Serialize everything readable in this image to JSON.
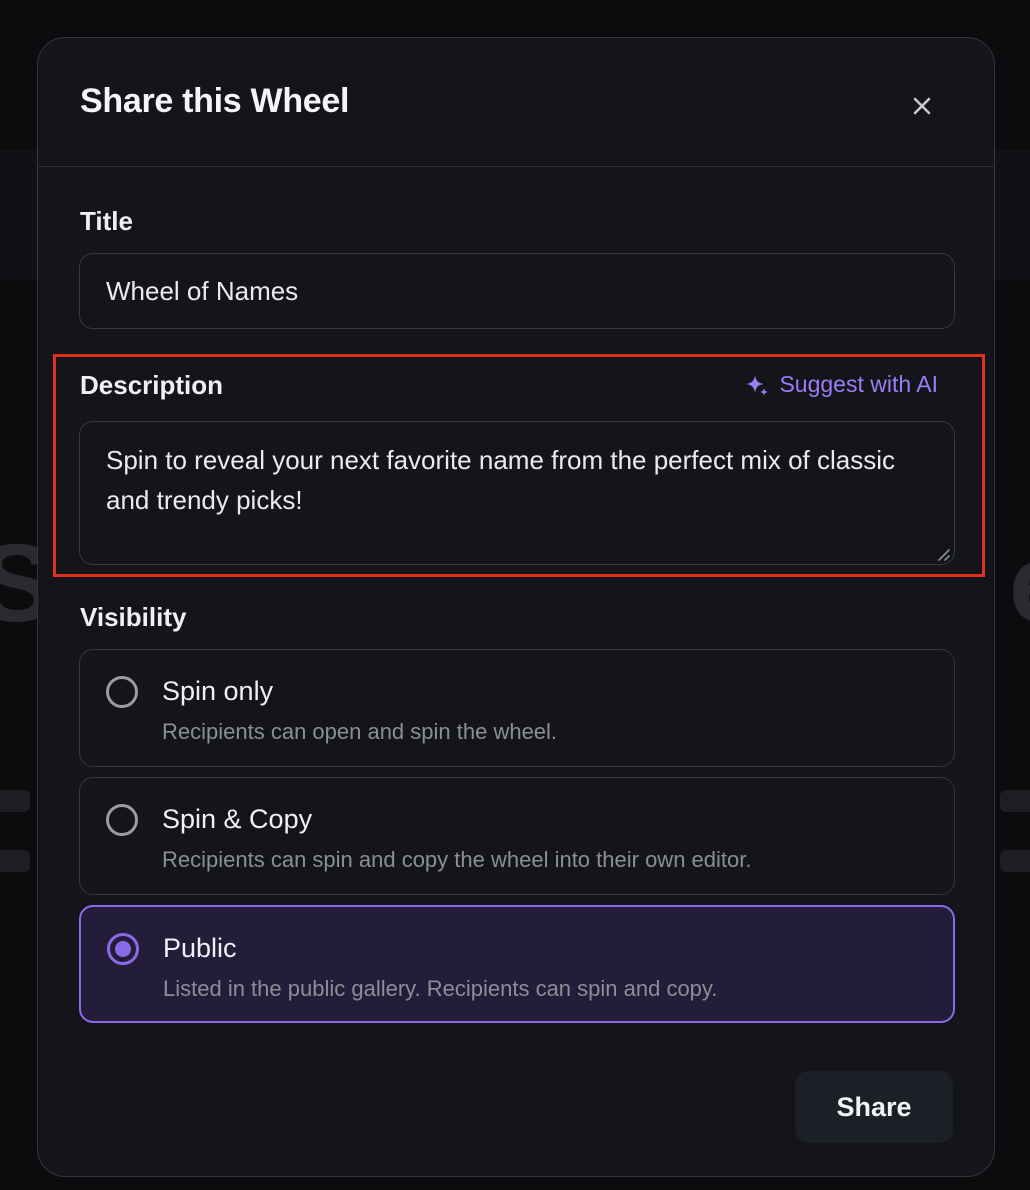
{
  "modal": {
    "title": "Share this Wheel"
  },
  "title_field": {
    "label": "Title",
    "value": "Wheel of Names"
  },
  "description_field": {
    "label": "Description",
    "suggest_label": "Suggest with AI",
    "value": "Spin to reveal your next favorite name from the perfect mix of classic and trendy picks!"
  },
  "visibility": {
    "label": "Visibility",
    "selected": "public",
    "options": [
      {
        "id": "spin-only",
        "title": "Spin only",
        "description": "Recipients can open and spin the wheel."
      },
      {
        "id": "spin-copy",
        "title": "Spin & Copy",
        "description": "Recipients can spin and copy the wheel into their own editor."
      },
      {
        "id": "public",
        "title": "Public",
        "description": "Listed in the public gallery. Recipients can spin and copy."
      }
    ]
  },
  "actions": {
    "share_label": "Share"
  },
  "colors": {
    "accent": "#8b6ae9",
    "highlight": "#e0301e"
  }
}
